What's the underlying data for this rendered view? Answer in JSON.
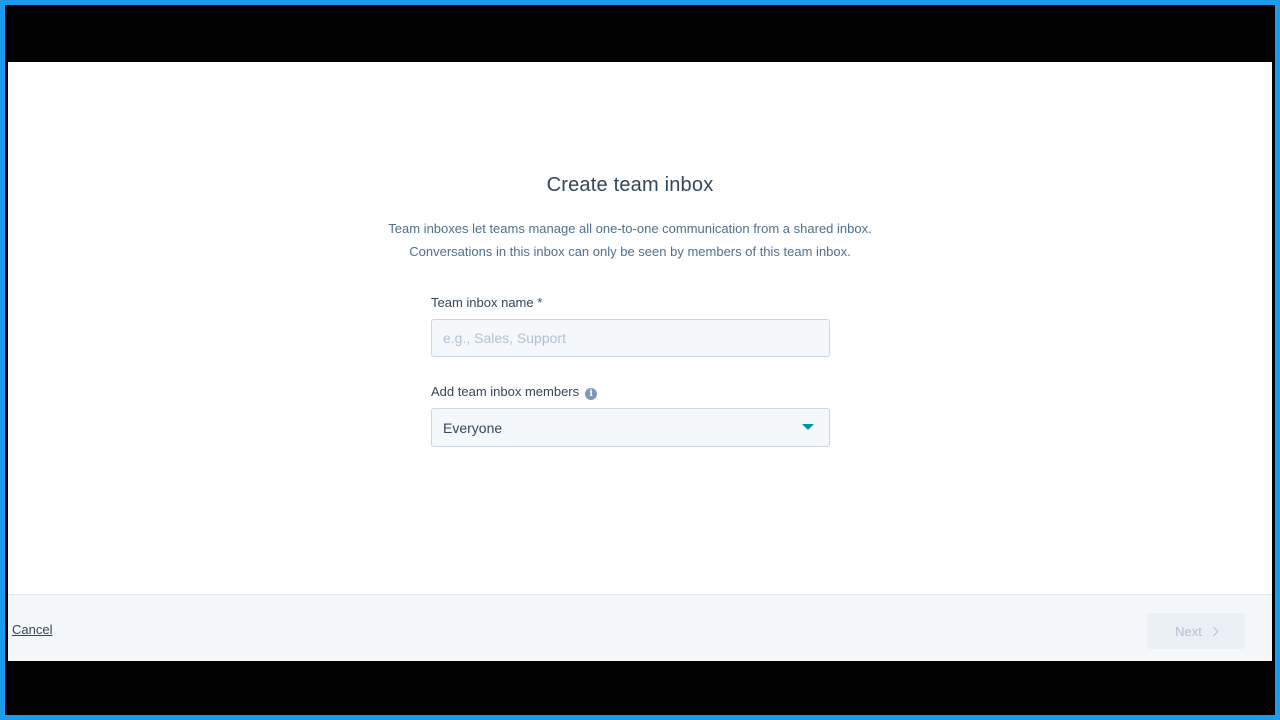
{
  "dialog": {
    "title": "Create team inbox",
    "description_line1": "Team inboxes let teams manage all one-to-one communication from a shared inbox.",
    "description_line2": "Conversations in this inbox can only be seen by members of this team inbox."
  },
  "form": {
    "name_label": "Team inbox name *",
    "name_value": "",
    "name_placeholder": "e.g., Sales, Support",
    "members_label": "Add team inbox members",
    "members_selected": "Everyone"
  },
  "footer": {
    "cancel_label": "Cancel",
    "next_label": "Next"
  },
  "colors": {
    "accent": "#0091ae",
    "text": "#33475b",
    "muted": "#516f90",
    "disabled": "#b0c1d4",
    "frame": "#1a9bf0"
  }
}
